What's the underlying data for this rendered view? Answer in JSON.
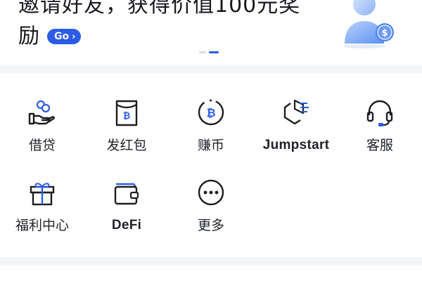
{
  "banner": {
    "title_line1": "邀请好友，获得价值100元奖",
    "title_line2": "励",
    "go_label": "Go",
    "go_chevron": "›",
    "illustration_icon": "user-dollar-icon",
    "carousel_pages": 2,
    "carousel_active_index": 1
  },
  "grid": {
    "items": [
      {
        "label": "借贷",
        "icon": "loan-hand-coins-icon"
      },
      {
        "label": "发红包",
        "icon": "red-packet-icon"
      },
      {
        "label": "赚币",
        "icon": "bitcoin-coin-icon"
      },
      {
        "label": "Jumpstart",
        "icon": "jumpstart-icon"
      },
      {
        "label": "客服",
        "icon": "headset-icon"
      },
      {
        "label": "福利中心",
        "icon": "gift-icon"
      },
      {
        "label": "DeFi",
        "icon": "wallet-icon"
      },
      {
        "label": "更多",
        "icon": "more-dots-icon"
      }
    ]
  },
  "colors": {
    "accent": "#2b5ce6",
    "icon_stroke": "#1b1d21",
    "background": "#f5f6f8"
  }
}
